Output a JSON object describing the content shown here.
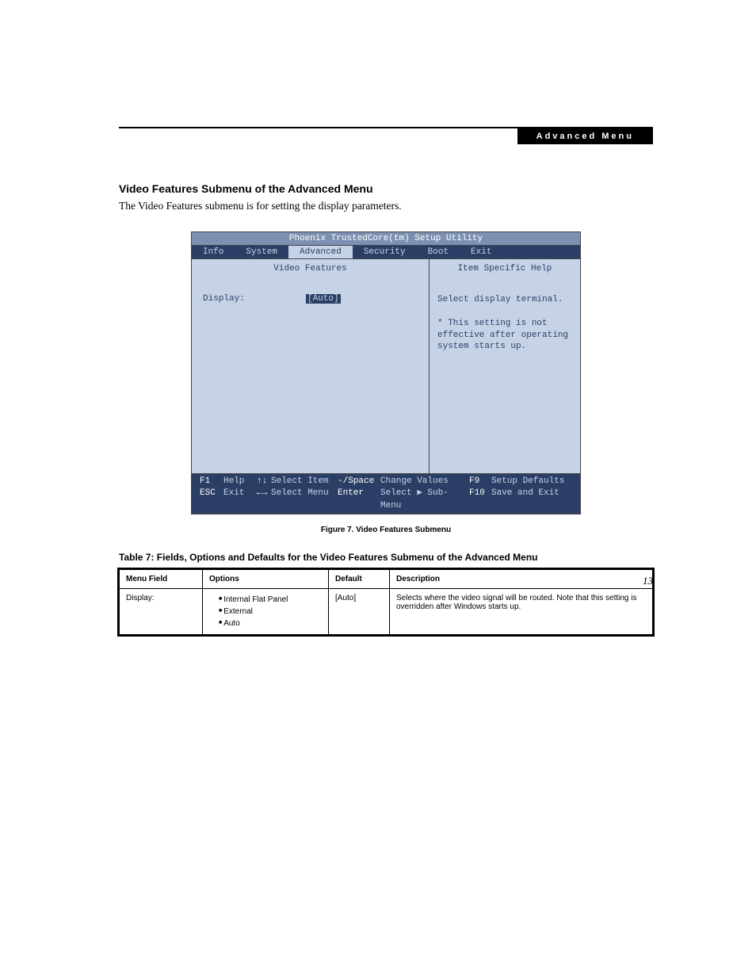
{
  "header": {
    "label": "Advanced Menu"
  },
  "section": {
    "title": "Video Features Submenu of the Advanced Menu",
    "text": "The Video Features submenu is for setting the display parameters."
  },
  "bios": {
    "window_title": "Phoenix TrustedCore(tm) Setup Utility",
    "tabs": [
      "Info",
      "System",
      "Advanced",
      "Security",
      "Boot",
      "Exit"
    ],
    "active_tab": "Advanced",
    "left_title": "Video Features",
    "setting_label": "Display:",
    "setting_value": "[Auto]",
    "right_title": "Item Specific Help",
    "help_text": "Select display terminal.\n\n* This setting is not effective after operating system starts up.",
    "footer": {
      "r1": {
        "k1": "F1",
        "l1": "Help",
        "a1": "↑↓",
        "l2": "Select Item",
        "k2": "-/Space",
        "l3": "Change Values",
        "k3": "F9",
        "l4": "Setup Defaults"
      },
      "r2": {
        "k1": "ESC",
        "l1": "Exit",
        "a1": "←→",
        "l2": "Select Menu",
        "k2": "Enter",
        "l3": "Select ▶ Sub-Menu",
        "k3": "F10",
        "l4": "Save and Exit"
      }
    }
  },
  "figure_caption": "Figure 7.  Video Features Submenu",
  "table_title": "Table 7: Fields, Options and Defaults for the Video Features Submenu of the Advanced Menu",
  "table": {
    "headers": [
      "Menu Field",
      "Options",
      "Default",
      "Description"
    ],
    "row": {
      "menu_field": "Display:",
      "options": [
        "Internal Flat Panel",
        "External",
        "Auto"
      ],
      "default": "[Auto]",
      "description": "Selects where the video signal will be routed. Note that this setting is overridden after Windows starts up."
    }
  },
  "page_number": "13"
}
